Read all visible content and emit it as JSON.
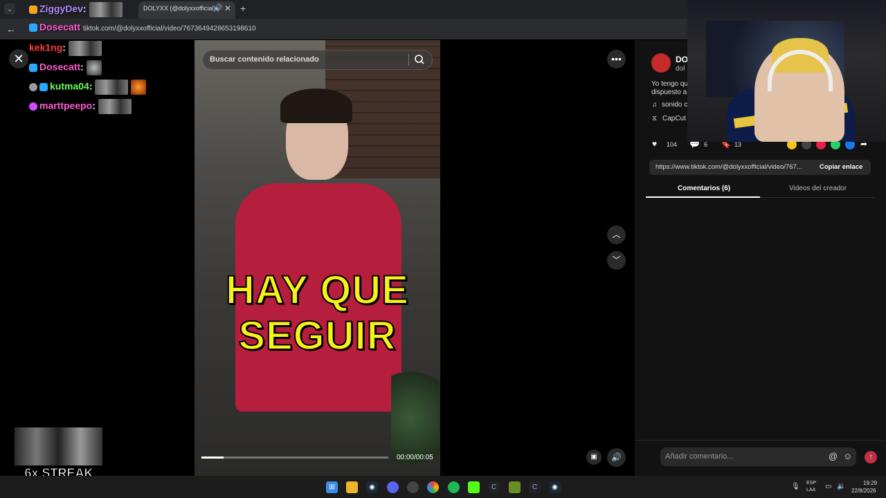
{
  "browser": {
    "tab_title": "DOLYXX (@dolyxxofficial) |",
    "url": "tiktok.com/@dolyxxofficial/video/7673649428653198610"
  },
  "chat": [
    {
      "user": "ZiggyDev",
      "color": "#b48cff"
    },
    {
      "user": "Dosecatt",
      "color": "#ff5ad2"
    },
    {
      "user": "kek1ng",
      "color": "#ff3b3b"
    },
    {
      "user": "Dosecatt",
      "color": "#ff5ad2"
    },
    {
      "user": "kutma04",
      "color": "#6dff5a"
    },
    {
      "user": "marttpeepo",
      "color": "#ff5ad2"
    }
  ],
  "video": {
    "search_placeholder": "Buscar contenido relacionado",
    "caption_line1": "HAY QUE",
    "caption_line2": "SEGUIR",
    "time": "00:00/00:05",
    "progress": 0.12
  },
  "panel": {
    "author_name": "DO",
    "author_sub": "dol",
    "desc_line1": "Yo tengo qu",
    "desc_line2": "dispuesto a",
    "sound_text": "sonido c",
    "capcut_text": "CapCut ·",
    "likes": "104",
    "comments": "6",
    "saves": "13",
    "link_text": "https://www.tiktok.com/@dolyxxofficial/video/767...",
    "copy_link": "Copiar enlace",
    "tab_comments": "Comentarios (6)",
    "tab_creator": "Videos del creador",
    "comment_placeholder": "Añadir comentario..."
  },
  "streak": {
    "label": "6x STREAK"
  },
  "tray": {
    "lang1": "ESP",
    "lang2": "LAA",
    "time": "19:29",
    "date": "22/8/2026"
  },
  "colors": {
    "caption": "#f5f21a",
    "accent": "#c23244"
  },
  "icons": {
    "close": "close-icon",
    "more": "more-icon",
    "search": "search-icon",
    "up": "chevron-up-icon",
    "down": "chevron-down-icon",
    "volume": "volume-icon"
  }
}
